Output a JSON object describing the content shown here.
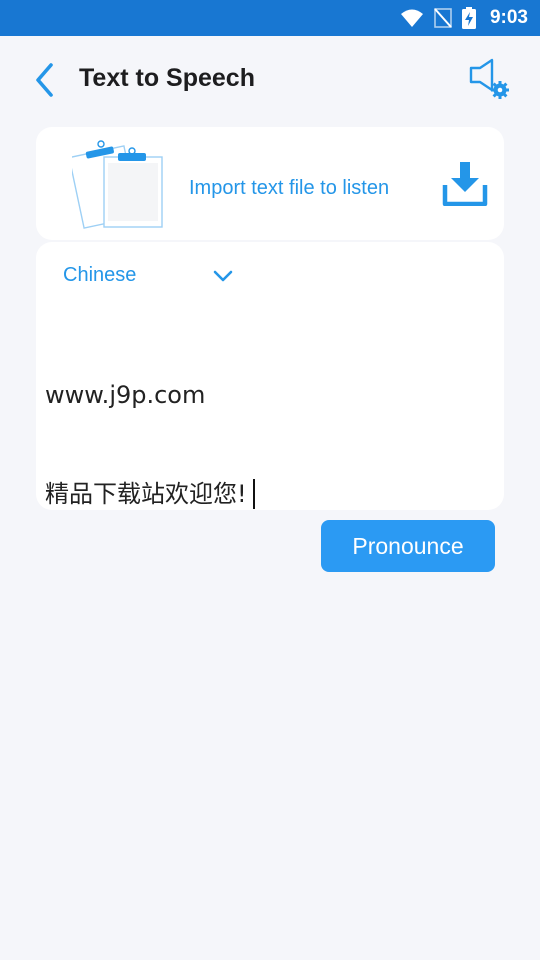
{
  "status_bar": {
    "time": "9:03",
    "icons": [
      "wifi-icon",
      "no-signal-icon",
      "battery-charging-icon"
    ]
  },
  "header": {
    "title": "Text to Speech",
    "back_icon": "chevron-left-icon",
    "settings_icon": "speaker-settings-icon"
  },
  "import": {
    "label": "Import text file to listen",
    "icon": "download-icon",
    "illustration": "clipboard-illustration"
  },
  "editor": {
    "language": "Chinese",
    "line1": "www.j9p.com",
    "line2": "精品下载站欢迎您!"
  },
  "actions": {
    "pronounce_label": "Pronounce"
  },
  "colors": {
    "status_bar": "#1877d2",
    "accent": "#2496e8",
    "button": "#2b9af3",
    "background": "#f5f6fa"
  }
}
